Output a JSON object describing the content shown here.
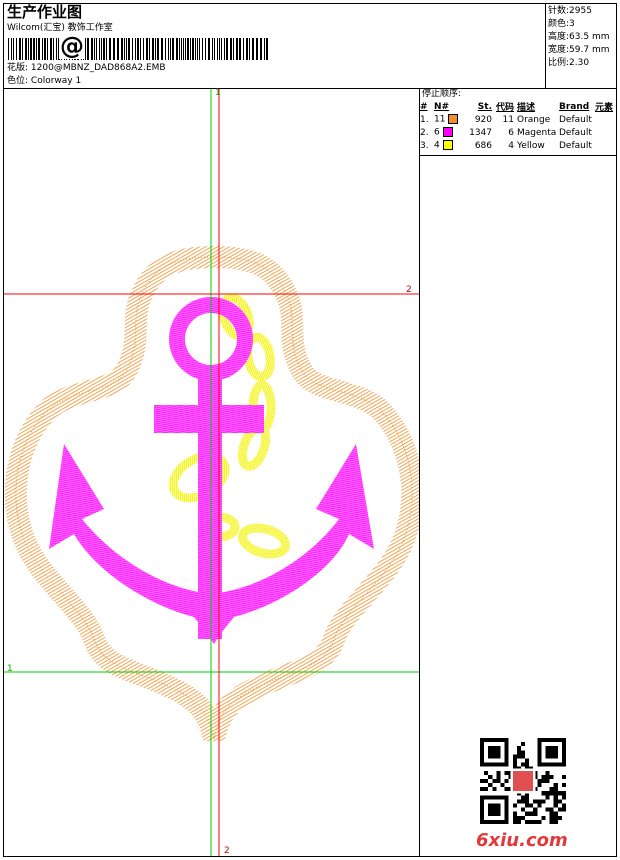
{
  "header": {
    "title": "生产作业图",
    "company": "Wilcom(汇宝) 教饰工作室",
    "barcode_symbol": "@",
    "design_label": "花版:",
    "design_value": "1200@MBNZ_DAD868A2.EMB",
    "colorway_label": "色位:",
    "colorway_value": "Colorway 1"
  },
  "stats": [
    {
      "label": "针数:",
      "value": "2955"
    },
    {
      "label": "颜色:",
      "value": "3"
    },
    {
      "label": "高度:",
      "value": "63.5 mm"
    },
    {
      "label": "宽度:",
      "value": "59.7 mm"
    },
    {
      "label": "比例:",
      "value": "2.30"
    }
  ],
  "stop_sequence": {
    "title": "停止顺序:",
    "columns": [
      "#",
      "N#",
      "St.",
      "代码",
      "描述",
      "Brand",
      "元素"
    ],
    "rows": [
      {
        "idx": "1.",
        "needle": "11",
        "color": "#f0902a",
        "stitches": "920",
        "code": "11",
        "desc": "Orange",
        "brand": "Default"
      },
      {
        "idx": "2.",
        "needle": "6",
        "color": "#ff00ff",
        "stitches": "1347",
        "code": "6",
        "desc": "Magenta",
        "brand": "Default"
      },
      {
        "idx": "3.",
        "needle": "4",
        "color": "#ffff00",
        "stitches": "686",
        "code": "4",
        "desc": "Yellow",
        "brand": "Default"
      }
    ]
  },
  "canvas": {
    "axis_labels": {
      "top": "1",
      "right": "2",
      "left": "1",
      "bottom": "2"
    },
    "colors": {
      "orange": "#f0902a",
      "magenta": "#ff00ff",
      "yellow": "#ffff00",
      "red_guide": "#ff0000",
      "green_guide": "#00cc00"
    }
  },
  "watermark": "6xiu.com"
}
